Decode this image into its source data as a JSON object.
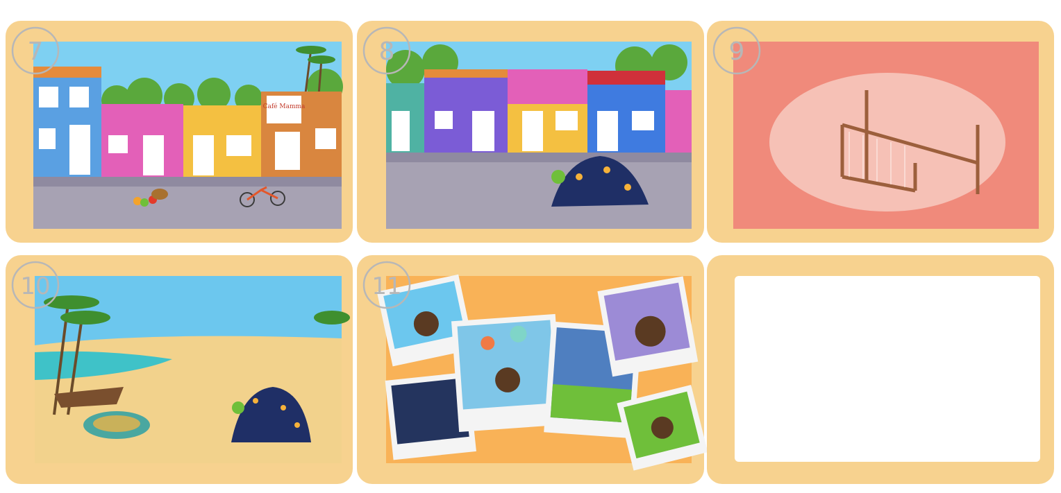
{
  "panels": [
    {
      "number": "7",
      "scene": "street",
      "sign_text": "Café Mamma"
    },
    {
      "number": "8",
      "scene": "street-creature"
    },
    {
      "number": "9",
      "scene": "loom"
    },
    {
      "number": "10",
      "scene": "beach"
    },
    {
      "number": "11",
      "scene": "polaroids"
    },
    {
      "number": "",
      "scene": "blank"
    }
  ],
  "colors": {
    "frame": "#f7d28f",
    "sky": "#6cc7ee",
    "road": "#a7a2b3",
    "loom_bg": "#f08a7b",
    "sand": "#f2d28c",
    "sea": "#3fc2c8",
    "orange_bg": "#f9b257"
  }
}
